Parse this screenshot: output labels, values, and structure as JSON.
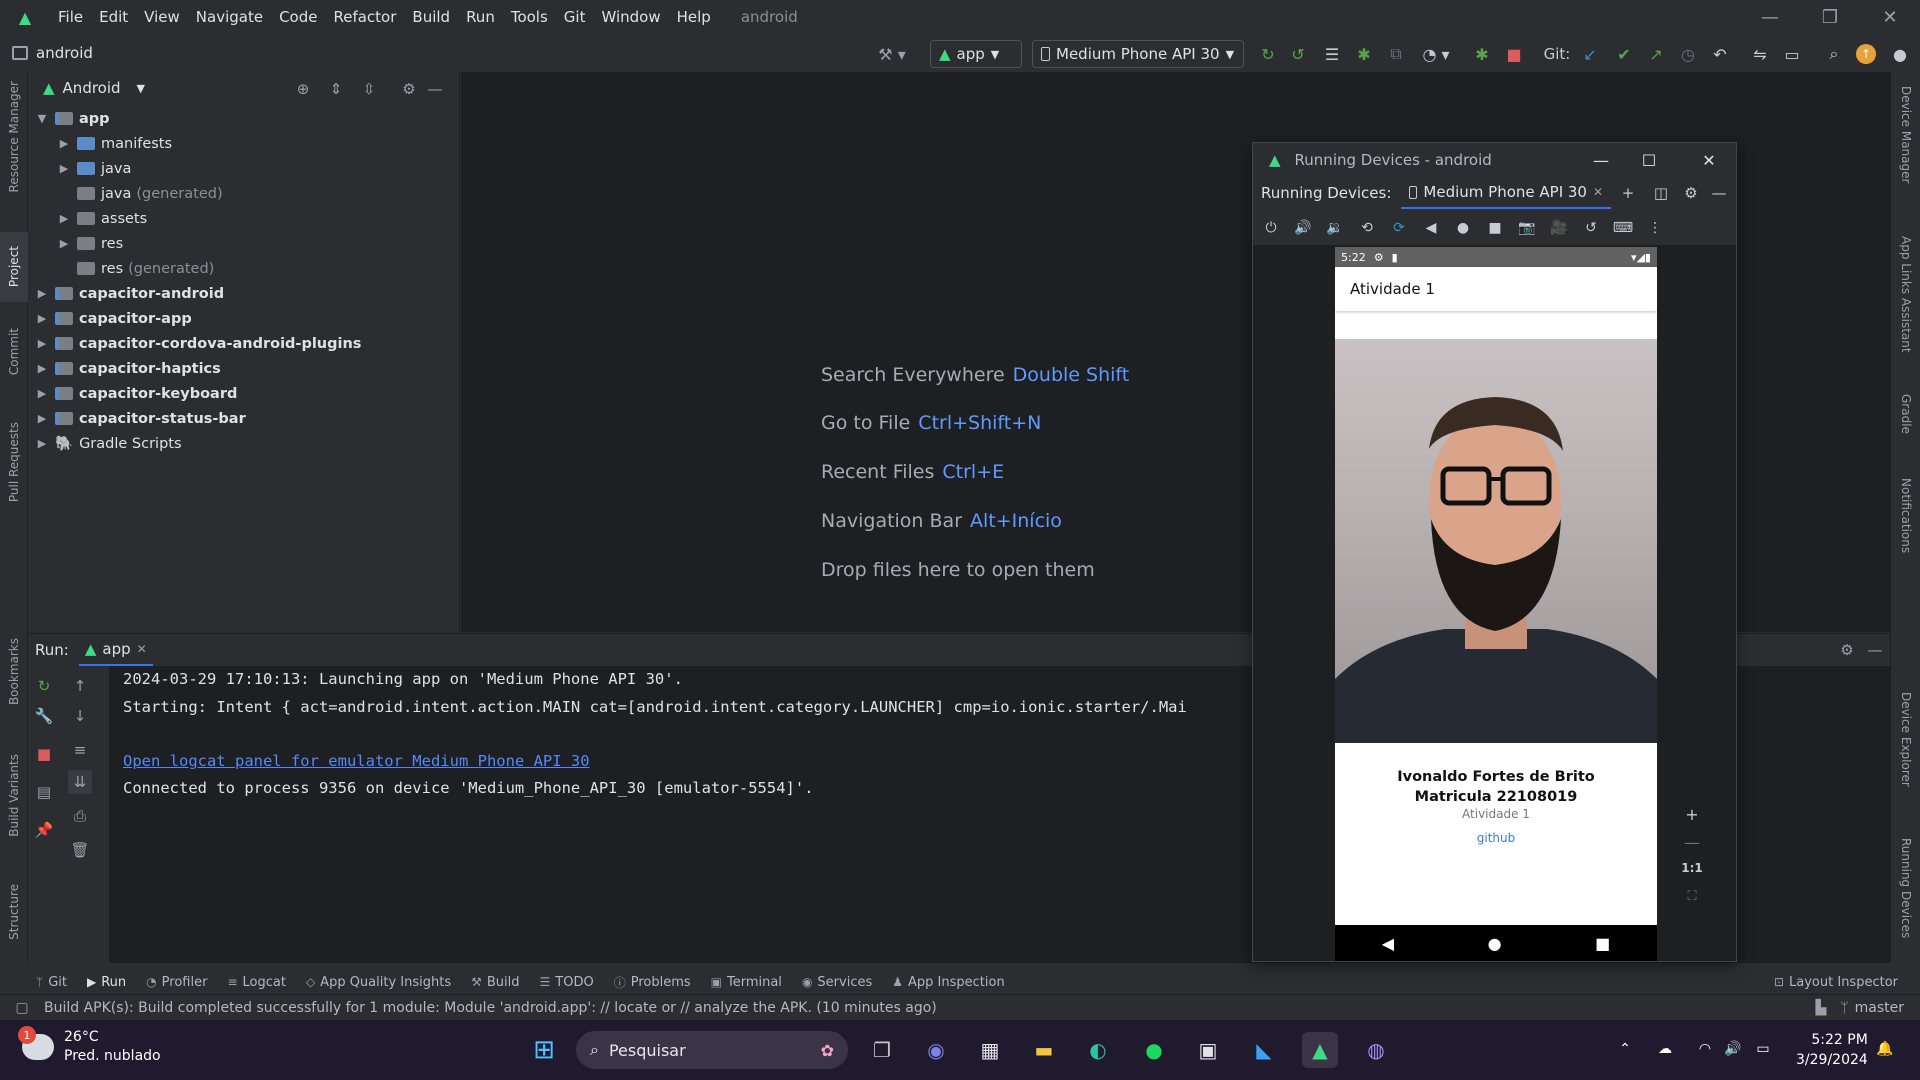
{
  "menubar": {
    "items": [
      "File",
      "Edit",
      "View",
      "Navigate",
      "Code",
      "Refactor",
      "Build",
      "Run",
      "Tools",
      "Git",
      "Window",
      "Help"
    ],
    "project_name": "android"
  },
  "toolbar": {
    "project": "android",
    "run_config": "app",
    "device": "Medium Phone API 30",
    "git_label": "Git:"
  },
  "left_stripe": [
    "Resource Manager",
    "Project",
    "Commit",
    "Pull Requests",
    "Bookmarks",
    "Build Variants",
    "Structure"
  ],
  "right_stripe": [
    "Device Manager",
    "App Links Assistant",
    "Gradle",
    "Notifications",
    "Device Explorer",
    "Running Devices"
  ],
  "project_panel": {
    "view_mode": "Android",
    "tree": [
      {
        "label": "app",
        "bold": true,
        "expanded": true
      },
      {
        "label": "manifests"
      },
      {
        "label": "java"
      },
      {
        "label": "java",
        "suffix": "(generated)"
      },
      {
        "label": "assets"
      },
      {
        "label": "res"
      },
      {
        "label": "res",
        "suffix": "(generated)"
      },
      {
        "label": "capacitor-android",
        "bold": true
      },
      {
        "label": "capacitor-app",
        "bold": true
      },
      {
        "label": "capacitor-cordova-android-plugins",
        "bold": true
      },
      {
        "label": "capacitor-haptics",
        "bold": true
      },
      {
        "label": "capacitor-keyboard",
        "bold": true
      },
      {
        "label": "capacitor-status-bar",
        "bold": true
      },
      {
        "label": "Gradle Scripts"
      }
    ]
  },
  "editor_hints": [
    {
      "text": "Search Everywhere",
      "key": "Double Shift"
    },
    {
      "text": "Go to File",
      "key": "Ctrl+Shift+N"
    },
    {
      "text": "Recent Files",
      "key": "Ctrl+E"
    },
    {
      "text": "Navigation Bar",
      "key": "Alt+Início"
    },
    {
      "text": "Drop files here to open them",
      "key": ""
    }
  ],
  "run_panel": {
    "label": "Run:",
    "tab": "app",
    "console": [
      "2024-03-29 17:10:13: Launching app on 'Medium Phone API 30'.",
      "Starting: Intent { act=android.intent.action.MAIN cat=[android.intent.category.LAUNCHER] cmp=io.ionic.starter/.Mai",
      "Open logcat panel for emulator Medium Phone API 30",
      "Connected to process 9356 on device 'Medium_Phone_API_30 [emulator-5554]'."
    ]
  },
  "running_devices": {
    "title": "Running Devices - android",
    "tabs_label": "Running Devices:",
    "tab": "Medium Phone API 30",
    "zoom_reset": "1:1"
  },
  "phone": {
    "status_time": "5:22",
    "app_title": "Atividade 1",
    "name": "Ivonaldo Fortes de Brito",
    "matricula": "Matricula 22108019",
    "subtitle": "Atividade 1",
    "link": "github"
  },
  "bottom_tabs": [
    "Git",
    "Run",
    "Profiler",
    "Logcat",
    "App Quality Insights",
    "Build",
    "TODO",
    "Problems",
    "Terminal",
    "Services",
    "App Inspection"
  ],
  "layout_inspector": "Layout Inspector",
  "status_bar": {
    "message": "Build APK(s): Build completed successfully for 1 module: Module 'android.app': // locate or // analyze the APK. (10 minutes ago)",
    "branch": "master"
  },
  "taskbar": {
    "weather_temp": "26°C",
    "weather_desc": "Pred. nublado",
    "weather_badge": "1",
    "search": "Pesquisar",
    "time": "5:22 PM",
    "date": "3/29/2024"
  }
}
